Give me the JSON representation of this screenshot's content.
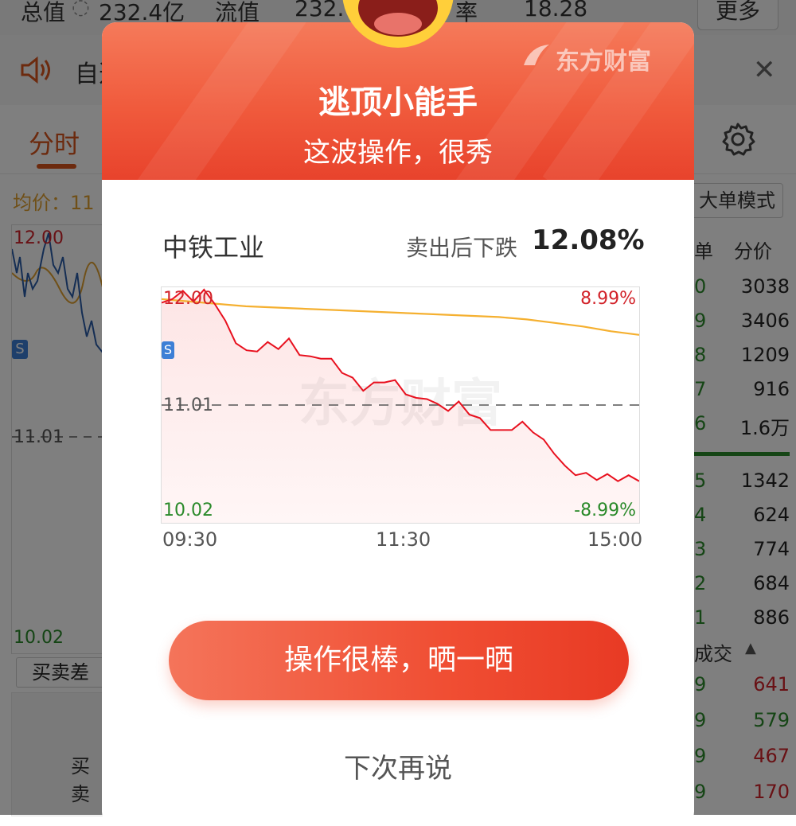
{
  "background": {
    "top_bar": {
      "total_value_label": "总值",
      "total_value": "232.4亿",
      "float_value_label": "流值",
      "float_value": "232.",
      "partial_label": "率",
      "partial_value": "18.28",
      "more_label": "更多"
    },
    "notice_partial": "自选",
    "tab_intraday": "分时",
    "avg_price_label": "均价：11",
    "big_order_mode": "大单模式",
    "chart_labels": {
      "high": "12.00",
      "mid": "11.01",
      "low": "10.02"
    },
    "s_badge": "S",
    "buy_sell_diff": "买卖差",
    "buy_sell_partial": "买卖",
    "right_col_header": [
      "单",
      "分价"
    ],
    "right_col_rows_top": [
      {
        "a": "0",
        "b": "3038"
      },
      {
        "a": "9",
        "b": "3406"
      },
      {
        "a": "8",
        "b": "1209"
      },
      {
        "a": "7",
        "b": "916"
      },
      {
        "a": "6",
        "b": "1.6万"
      }
    ],
    "right_col_rows_bottom": [
      {
        "a": "5",
        "b": "1342"
      },
      {
        "a": "4",
        "b": "624"
      },
      {
        "a": "3",
        "b": "774"
      },
      {
        "a": "2",
        "b": "684"
      },
      {
        "a": "1",
        "b": "886"
      }
    ],
    "trades_header": "成交",
    "trades_rows": [
      {
        "a": "9",
        "b": "641",
        "color": "#d2232a"
      },
      {
        "a": "9",
        "b": "579",
        "color": "#2a8a2a"
      },
      {
        "a": "9",
        "b": "467",
        "color": "#d2232a"
      },
      {
        "a": "9",
        "b": "170",
        "color": "#d2232a"
      }
    ]
  },
  "modal": {
    "brand": "东方财富",
    "title": "逃顶小能手",
    "subtitle": "这波操作，很秀",
    "stock_name": "中铁工业",
    "drop_label": "卖出后下跌",
    "drop_value": "12.08%",
    "chart": {
      "price_high": "12.00",
      "price_ref": "11.01",
      "price_low": "10.02",
      "pct_high": "8.99%",
      "pct_low": "-8.99%",
      "s_badge": "S",
      "time_start": "09:30",
      "time_mid": "11:30",
      "time_end": "15:00",
      "watermark": "东方财富"
    },
    "share_button": "操作很棒，晒一晒",
    "later_button": "下次再说"
  },
  "colors": {
    "accent_orange": "#d9541c",
    "header_red": "#f05a3c",
    "price_line": "#e8101e",
    "avg_line": "#f5b030",
    "up_red": "#d2232a",
    "down_green": "#2a8a2a"
  },
  "chart_data": {
    "type": "line",
    "title": "",
    "xlabel": "",
    "ylabel": "",
    "x_ticks": [
      "09:30",
      "11:30",
      "15:00"
    ],
    "ylim": [
      10.02,
      12.0
    ],
    "reference": 11.01,
    "series": [
      {
        "values": [
          11.85,
          11.92,
          11.95,
          11.9,
          11.96,
          11.88,
          11.7,
          11.55,
          11.45,
          11.48,
          11.52,
          11.5,
          11.55,
          11.45,
          11.4,
          11.42,
          11.38,
          11.3,
          11.22,
          11.15,
          11.18,
          11.22,
          11.2,
          11.12,
          11.05,
          11.08,
          11.0,
          10.98,
          11.02,
          10.95,
          10.88,
          10.82,
          10.78,
          10.82,
          10.85,
          10.8,
          10.7,
          10.62,
          10.48,
          10.44,
          10.42,
          10.4,
          10.41,
          10.39,
          10.4,
          10.39
        ]
      },
      {
        "values": [
          11.9,
          11.88,
          11.86,
          11.84,
          11.83,
          11.82,
          11.81,
          11.8,
          11.79,
          11.78,
          11.77,
          11.76,
          11.75,
          11.73,
          11.7,
          11.67,
          11.63,
          11.6
        ]
      }
    ]
  }
}
